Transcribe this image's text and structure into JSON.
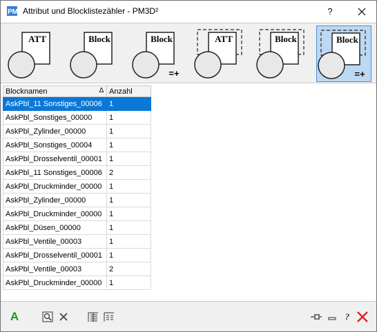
{
  "window": {
    "title": "Attribut und  Blocklistezähler - PM3D²",
    "help_label": "?"
  },
  "modes": [
    {
      "name": "att",
      "label": "ATT",
      "suffix": "",
      "dashed": false,
      "active": false
    },
    {
      "name": "block",
      "label": "Block",
      "suffix": "",
      "dashed": false,
      "active": false
    },
    {
      "name": "block-count",
      "label": "Block",
      "suffix": "=+",
      "dashed": false,
      "active": false
    },
    {
      "name": "att-window",
      "label": "ATT",
      "suffix": "",
      "dashed": true,
      "active": false
    },
    {
      "name": "block-window",
      "label": "Block",
      "suffix": "",
      "dashed": true,
      "active": false
    },
    {
      "name": "block-count-window",
      "label": "Block",
      "suffix": "=+",
      "dashed": true,
      "active": true
    }
  ],
  "table": {
    "columns": [
      "Blocknamen",
      "Anzahl"
    ],
    "sort_indicator": "∆",
    "rows": [
      {
        "name": "AskPbl_11   Sonstiges_00006",
        "count": "1",
        "selected": true
      },
      {
        "name": "AskPbl_Sonstiges_00000",
        "count": "1"
      },
      {
        "name": "AskPbl_Zylinder_00000",
        "count": "1"
      },
      {
        "name": "AskPbl_Sonstiges_00004",
        "count": "1"
      },
      {
        "name": "AskPbl_Drosselventil_00001",
        "count": "1"
      },
      {
        "name": "AskPbl_11   Sonstiges_00006",
        "count": "2"
      },
      {
        "name": "AskPbl_Druckminder_00000",
        "count": "1"
      },
      {
        "name": "AskPbl_Zylinder_00000",
        "count": "1"
      },
      {
        "name": "AskPbl_Druckminder_00000",
        "count": "1"
      },
      {
        "name": "AskPbl_Düsen_00000",
        "count": "1"
      },
      {
        "name": "AskPbl_Ventile_00003",
        "count": "1"
      },
      {
        "name": "AskPbl_Drosselventil_00001",
        "count": "1"
      },
      {
        "name": "AskPbl_Ventile_00003",
        "count": "2"
      },
      {
        "name": "AskPbl_Druckminder_00000",
        "count": "1"
      }
    ]
  },
  "bottom": {
    "attribute_label": "A",
    "help_label": "?",
    "colors": {
      "green": "#1a9a1a",
      "red": "#e02020",
      "accent": "#0a78d7"
    }
  }
}
